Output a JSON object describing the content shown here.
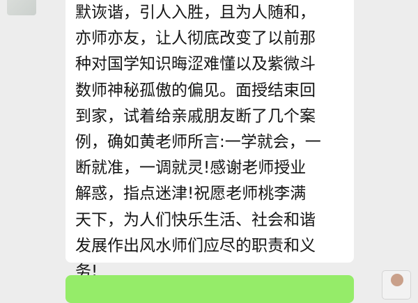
{
  "chat": {
    "incoming_message": {
      "lines": [
        "默诙谐，引人入胜，且为人随和，",
        "亦师亦友，让人彻底改变了以前那",
        "种对国学知识晦涩难懂以及紫微斗",
        "数师神秘孤傲的偏见。面授结束回",
        "到家，试着给亲戚朋友断了几个案",
        "例，确如黄老师所言:一学就会，一",
        "断就准，一调就灵!感谢老师授业",
        "解惑，指点迷津!祝愿老师桃李满",
        "天下，为人们快乐生活、社会和谐",
        "发展作出风水师们应尽的职责和义",
        "务!"
      ]
    }
  },
  "colors": {
    "chat_background": "#ededed",
    "incoming_bubble": "#ffffff",
    "outgoing_bubble": "#95ec69",
    "text": "#151515"
  }
}
